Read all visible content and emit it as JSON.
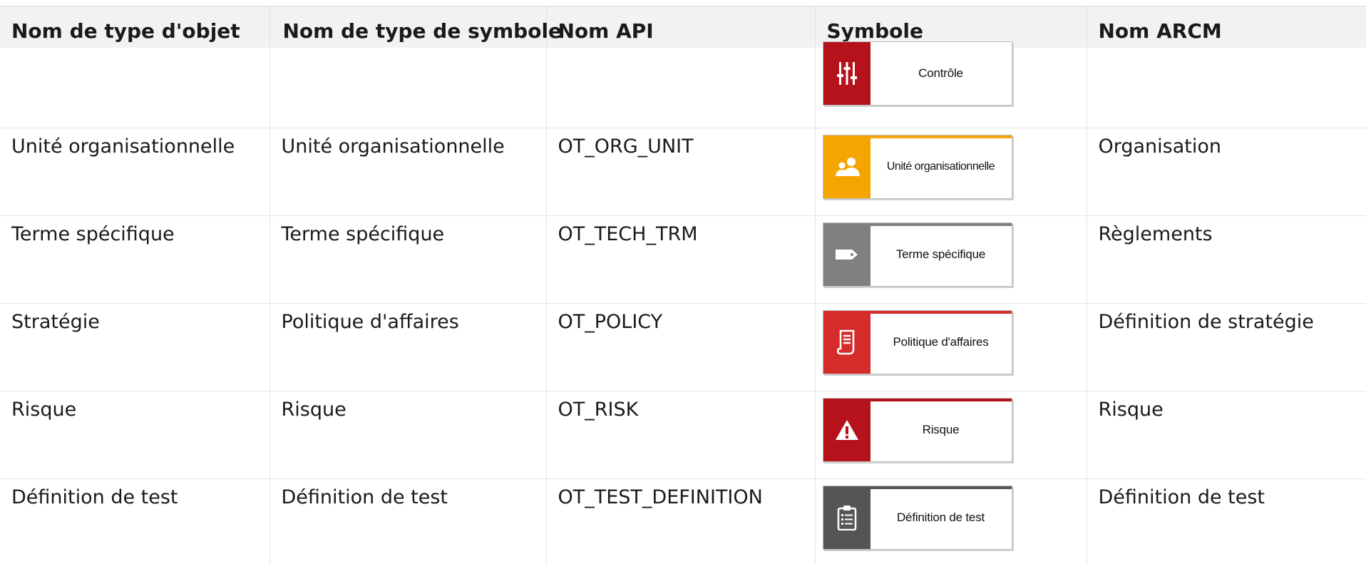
{
  "headers": [
    "Nom de type d'objet",
    "Nom de type de symbole",
    "Nom API",
    "Symbole",
    "Nom ARCM"
  ],
  "rows": [
    {
      "object_type": "",
      "symbol_type": "",
      "api_name": "",
      "symbol_label": "Contrôle",
      "symbol_color": "#b5121b",
      "symbol_icon": "sliders-icon",
      "arcm_name": ""
    },
    {
      "object_type": "Unité organisationnelle",
      "symbol_type": "Unité organisationnelle",
      "api_name": "OT_ORG_UNIT",
      "symbol_label": "Unité organisationnelle",
      "symbol_color": "#f5a500",
      "symbol_icon": "people-icon",
      "arcm_name": "Organisation"
    },
    {
      "object_type": "Terme spécifique",
      "symbol_type": "Terme spécifique",
      "api_name": "OT_TECH_TRM",
      "symbol_label": "Terme spécifique",
      "symbol_color": "#808080",
      "symbol_icon": "tag-icon",
      "arcm_name": "Règlements"
    },
    {
      "object_type": "Stratégie",
      "symbol_type": "Politique d'affaires",
      "api_name": "OT_POLICY",
      "symbol_label": "Politique d'affaires",
      "symbol_color": "#d42b2b",
      "symbol_icon": "scroll-icon",
      "arcm_name": "Définition de stratégie"
    },
    {
      "object_type": "Risque",
      "symbol_type": "Risque",
      "api_name": "OT_RISK",
      "symbol_label": "Risque",
      "symbol_color": "#b5121b",
      "symbol_icon": "warning-icon",
      "arcm_name": "Risque"
    },
    {
      "object_type": "Définition de test",
      "symbol_type": "Définition de test",
      "api_name": "OT_TEST_DEFINITION",
      "symbol_label": "Définition de test",
      "symbol_color": "#555555",
      "symbol_icon": "clipboard-icon",
      "arcm_name": "Définition de test"
    }
  ]
}
